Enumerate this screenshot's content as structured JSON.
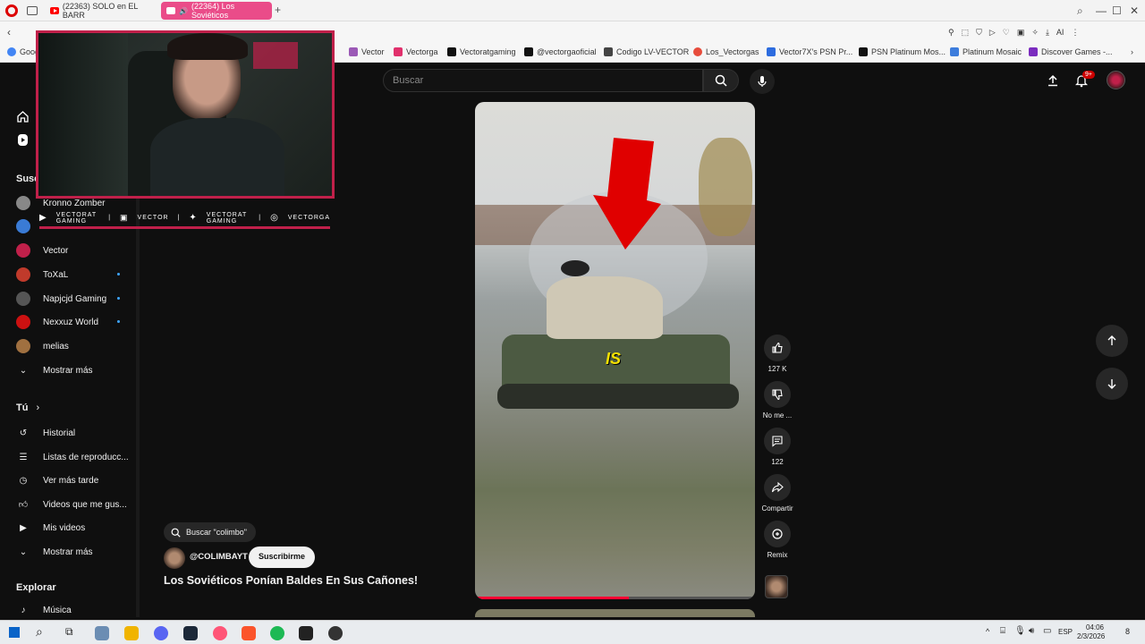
{
  "browser": {
    "tabs": [
      {
        "label": "(22363) SOLO en EL BARR"
      },
      {
        "label": "(22364) Los Soviéticos"
      }
    ],
    "new_tab": "+",
    "bookmarks": [
      {
        "label": "Vector",
        "color": "#9b59b6"
      },
      {
        "label": "Vectorga",
        "color": "#e1306c"
      },
      {
        "label": "Vectoratgaming",
        "color": "#111111"
      },
      {
        "label": "@vectorgaoficial",
        "color": "#111111"
      },
      {
        "label": "Codigo LV-VECTOR",
        "color": "#444444"
      },
      {
        "label": "Los_Vectorgas",
        "color": "#e74c3c"
      },
      {
        "label": "Vector7X's PSN Pr...",
        "color": "#2d6cdf"
      },
      {
        "label": "PSN Platinum Mos...",
        "color": "#111111"
      },
      {
        "label": "Platinum Mosaic",
        "color": "#3d7ddc"
      },
      {
        "label": "Discover Games -...",
        "color": "#7b2cbf"
      }
    ],
    "bookmark_cut": "Goog"
  },
  "youtube": {
    "search_placeholder": "Buscar",
    "notification_badge": "9+",
    "sidebar": {
      "subs_heading": "Susc",
      "subscriptions": [
        {
          "name": "Kronno Zomber",
          "color": "#888888",
          "live": false
        },
        {
          "name": "",
          "color": "#3a7bd5",
          "live": false
        },
        {
          "name": "Vector",
          "color": "#c0204a",
          "live": false
        },
        {
          "name": "ToXaL",
          "color": "#c03a2b",
          "live": true
        },
        {
          "name": "Napjcjd Gaming",
          "color": "#555555",
          "live": true
        },
        {
          "name": "Nexxuz World",
          "color": "#cc1111",
          "live": true
        },
        {
          "name": "melias",
          "color": "#a07040",
          "live": false
        }
      ],
      "more_subs": "Mostrar más",
      "you_heading": "Tú",
      "you_items": [
        {
          "label": "Historial",
          "icon": "history-icon"
        },
        {
          "label": "Listas de reproducc...",
          "icon": "playlist-icon"
        },
        {
          "label": "Ver más tarde",
          "icon": "clock-icon"
        },
        {
          "label": "Videos que me gus...",
          "icon": "thumb-up-icon"
        },
        {
          "label": "Mis videos",
          "icon": "play-square-icon"
        }
      ],
      "more_you": "Mostrar más",
      "explore_heading": "Explorar",
      "explore_items": [
        {
          "label": "Música",
          "icon": "music-icon"
        }
      ]
    },
    "short": {
      "search_chip": "Buscar \"colimbo\"",
      "channel": "@COLIMBAYT",
      "subscribe": "Suscribirme",
      "title": "Los Soviéticos Ponían Baldes En Sus Cañones!",
      "caption": "IS",
      "progress": 0.55,
      "actions": [
        {
          "label": "127 K",
          "icon": "like-icon"
        },
        {
          "label": "No me ...",
          "icon": "dislike-icon"
        },
        {
          "label": "122",
          "icon": "comment-icon"
        },
        {
          "label": "Compartir",
          "icon": "share-icon"
        },
        {
          "label": "Remix",
          "icon": "remix-icon"
        }
      ]
    }
  },
  "overlay": {
    "socials": [
      "VECTORAT GAMING",
      "VECTOR",
      "VECTORAT GAMING",
      "VECTORGA"
    ]
  },
  "taskbar": {
    "lang": "ESP",
    "time": "04:06",
    "date": "2/3/2026",
    "notif_count": "8"
  }
}
